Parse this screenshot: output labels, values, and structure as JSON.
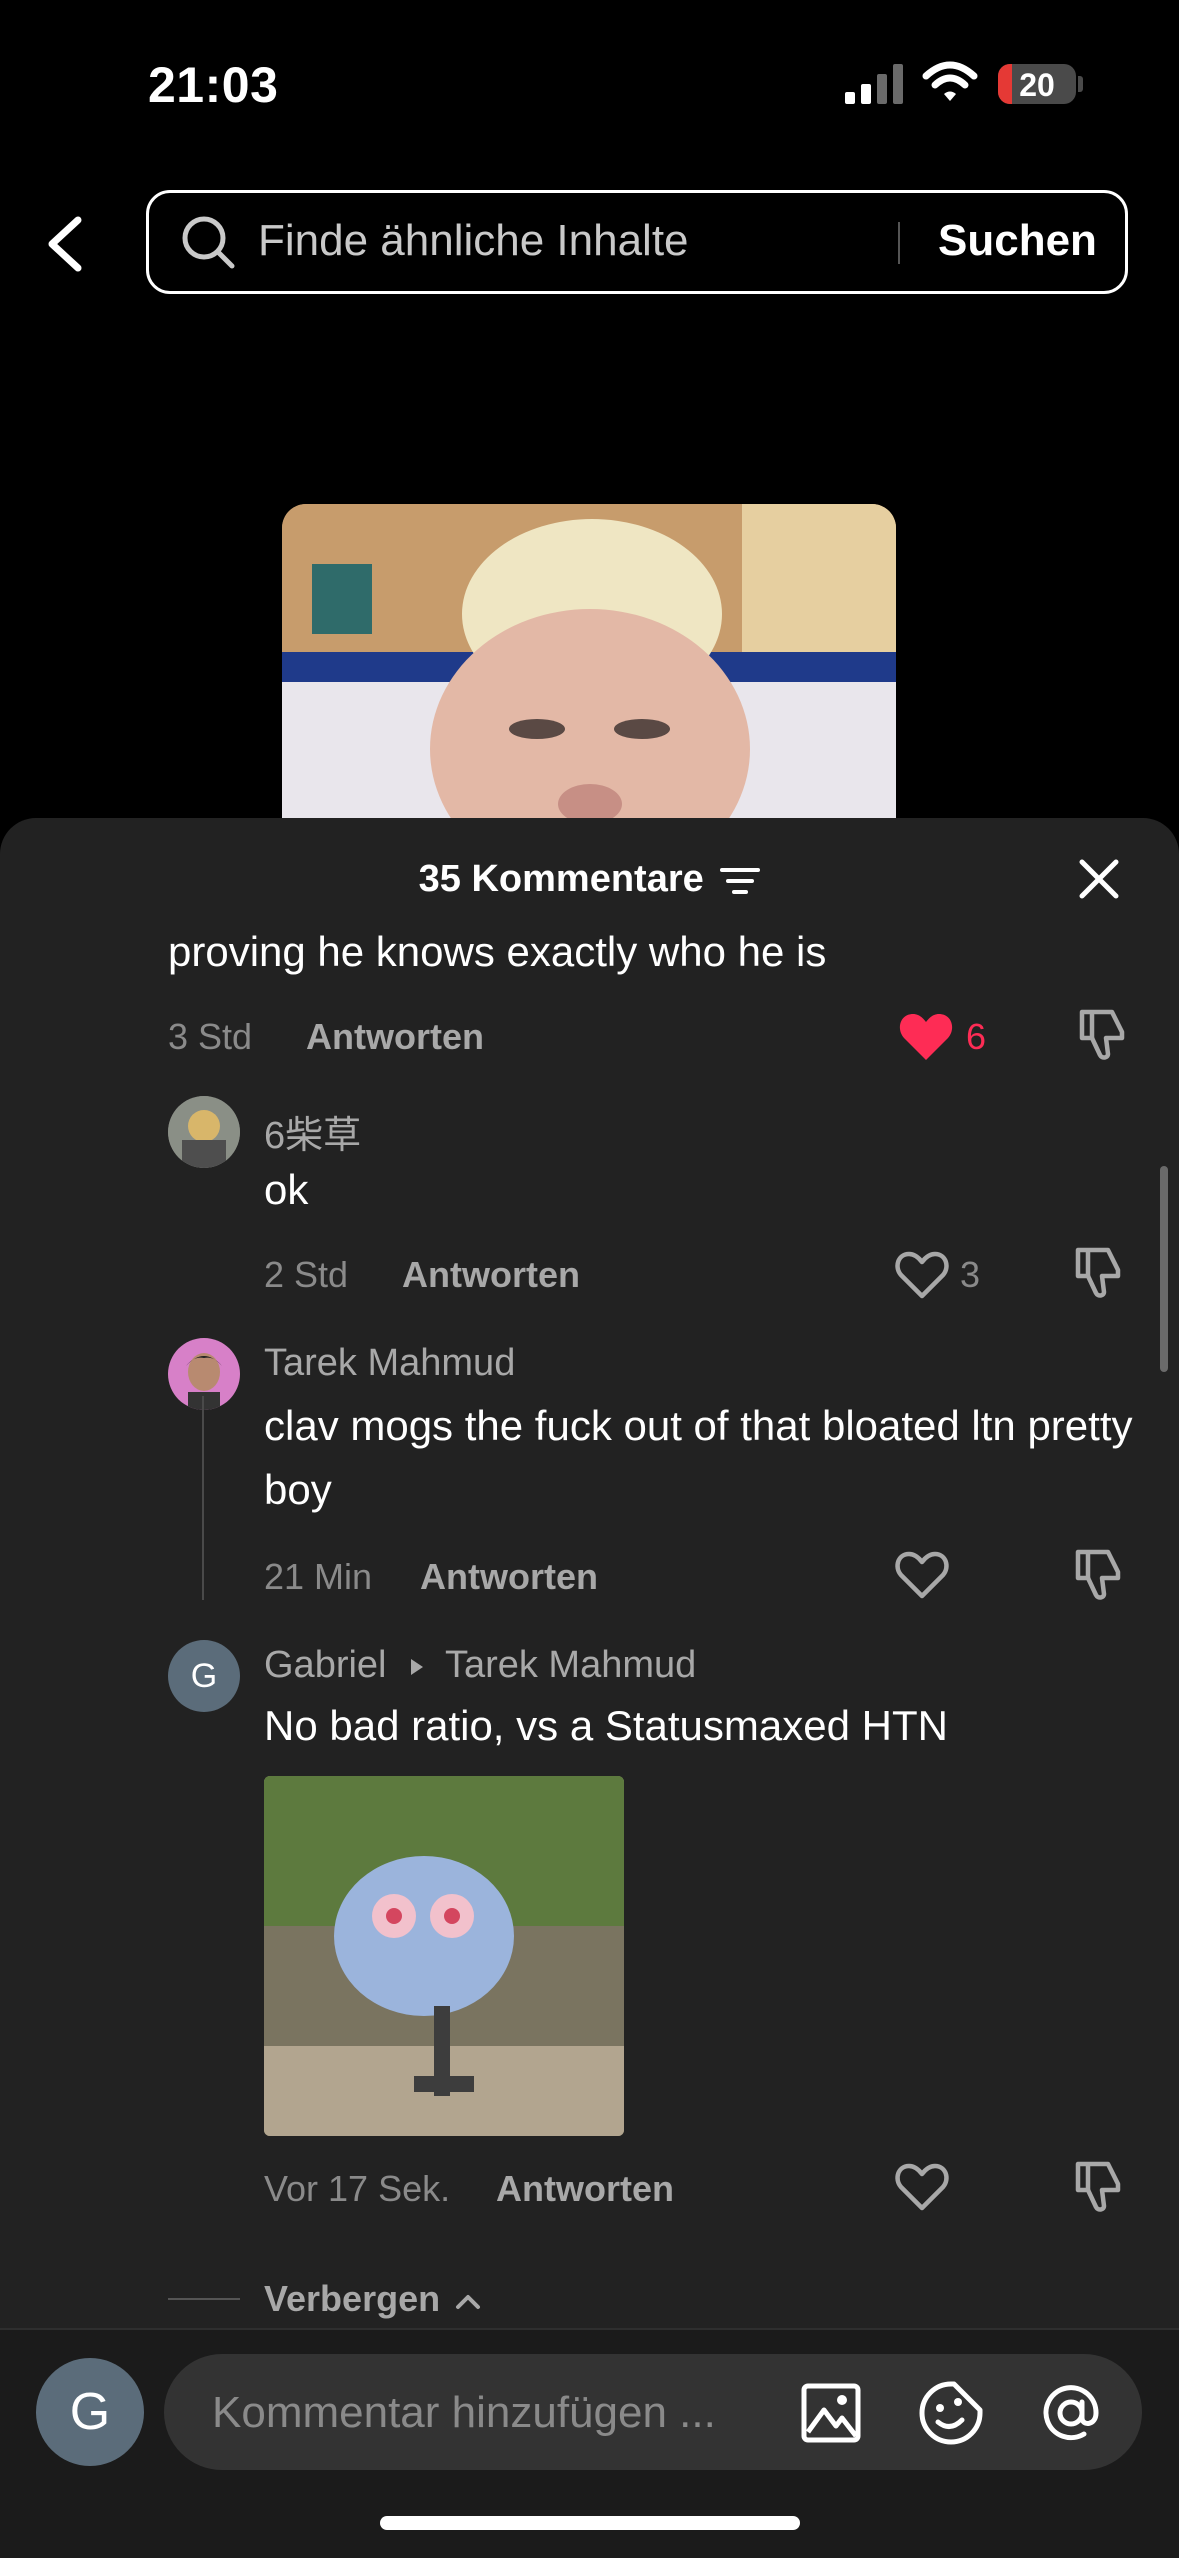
{
  "status_bar": {
    "time": "21:03",
    "battery": "20"
  },
  "search": {
    "placeholder": "Finde ähnliche Inhalte",
    "button": "Suchen"
  },
  "comments_sheet": {
    "title": "35 Kommentare",
    "comments": [
      {
        "text": "proving he knows exactly who he is",
        "time": "3 Std",
        "reply_label": "Antworten",
        "likes": "6",
        "liked": true
      },
      {
        "username": "6柴草",
        "text": "ok",
        "time": "2 Std",
        "reply_label": "Antworten",
        "likes": "3"
      },
      {
        "username": "Tarek Mahmud",
        "text": "clav mogs the fuck out of that bloated ltn pretty boy",
        "time": "21 Min",
        "reply_label": "Antworten"
      },
      {
        "username": "Gabriel",
        "reply_to": "Tarek Mahmud",
        "avatar_letter": "G",
        "text": "No bad ratio, vs a Statusmaxed HTN",
        "time": "Vor 17 Sek.",
        "reply_label": "Antworten"
      }
    ],
    "hide_label": "Verbergen"
  },
  "composer": {
    "avatar_letter": "G",
    "placeholder": "Kommentar hinzufügen ..."
  },
  "colors": {
    "like_red": "#fe2c55",
    "sheet_bg": "#222222"
  }
}
